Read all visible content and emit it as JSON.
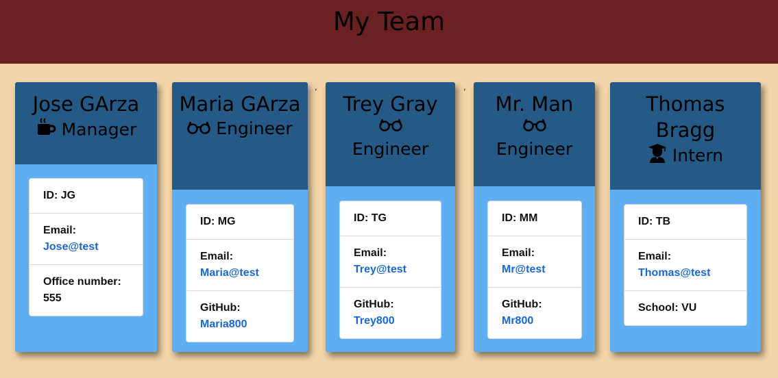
{
  "header": {
    "title": "My Team"
  },
  "cards": [
    {
      "name": "Jose GArza",
      "role": "Manager",
      "icon": "coffee-icon",
      "id_text": "ID: JG",
      "email_label": "Email:",
      "email": "Jose@test",
      "extra_label": "Office number:",
      "extra_value": "555"
    },
    {
      "name": "Maria GArza",
      "role": "Engineer",
      "icon": "glasses-icon",
      "id_text": "ID: MG",
      "email_label": "Email:",
      "email": "Maria@test",
      "extra_label": "GitHub:",
      "extra_value": "Maria800"
    },
    {
      "name": "Trey Gray",
      "role": "Engineer",
      "icon": "glasses-icon",
      "id_text": "ID: TG",
      "email_label": "Email:",
      "email": "Trey@test",
      "extra_label": "GitHub:",
      "extra_value": "Trey800"
    },
    {
      "name": "Mr. Man",
      "role": "Engineer",
      "icon": "glasses-icon",
      "id_text": "ID: MM",
      "email_label": "Email:",
      "email": "Mr@test",
      "extra_label": "GitHub:",
      "extra_value": "Mr800"
    },
    {
      "name": "Thomas Bragg",
      "role": "Intern",
      "icon": "graduate-icon",
      "id_text": "ID: TB",
      "school_text": "School: VU",
      "email_label": "Email:",
      "email": "Thomas@test"
    }
  ],
  "stray_marks": [
    ",",
    ","
  ],
  "colors": {
    "page_bg": "#f2d4a7",
    "header_bg": "#6b2121",
    "card_head_bg": "#245a85",
    "card_body_bg": "#5daef2",
    "link": "#1668d6"
  }
}
